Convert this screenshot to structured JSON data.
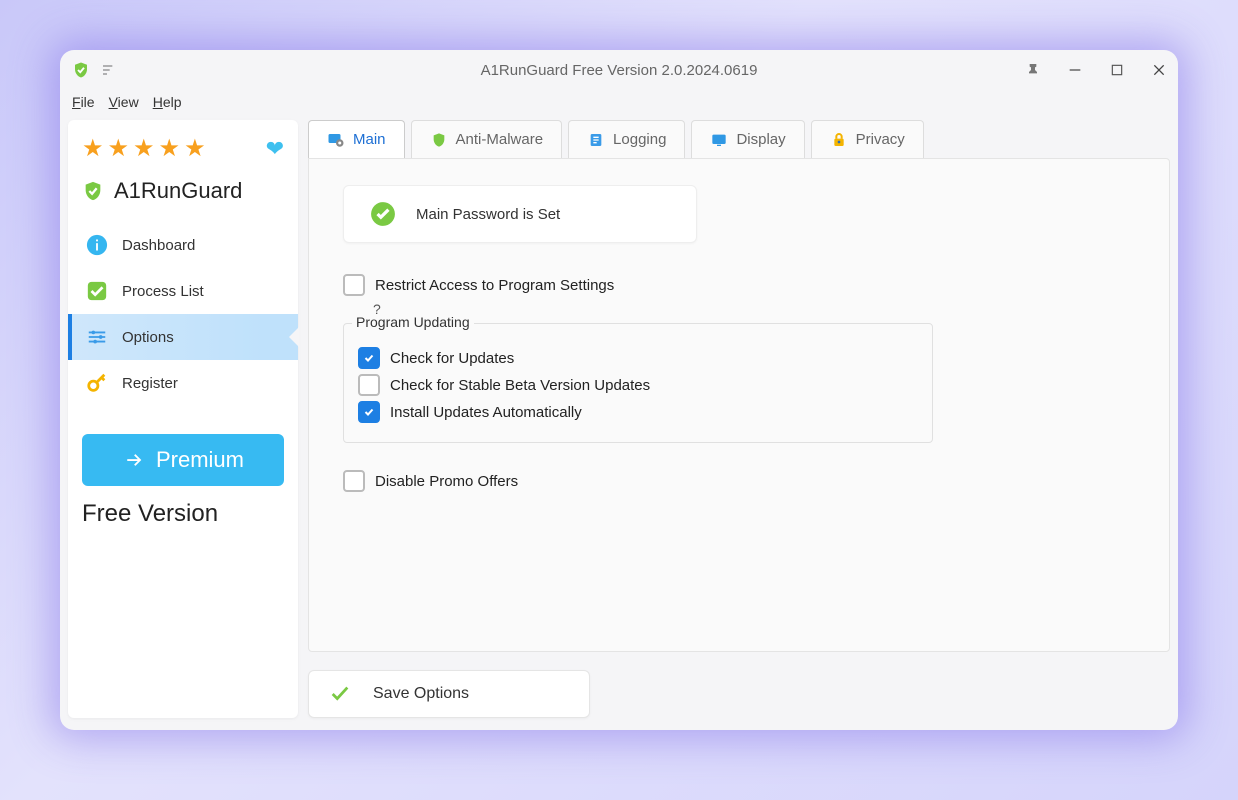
{
  "window": {
    "title": "A1RunGuard  Free Version 2.0.2024.0619"
  },
  "menu": {
    "file": "File",
    "view": "View",
    "help": "Help"
  },
  "sidebar": {
    "brand": "A1RunGuard",
    "items": [
      {
        "label": "Dashboard"
      },
      {
        "label": "Process List"
      },
      {
        "label": "Options"
      },
      {
        "label": "Register"
      }
    ],
    "premium_label": "Premium",
    "free_label": "Free Version"
  },
  "tabs": [
    {
      "label": "Main"
    },
    {
      "label": "Anti-Malware"
    },
    {
      "label": "Logging"
    },
    {
      "label": "Display"
    },
    {
      "label": "Privacy"
    }
  ],
  "main": {
    "password_card": "Main Password is Set",
    "restrict_label": "Restrict Access to Program Settings",
    "help_mark": "?",
    "group_title": "Program Updating",
    "check_updates": "Check for Updates",
    "check_beta": "Check for Stable Beta Version Updates",
    "install_auto": "Install Updates Automatically",
    "disable_promo": "Disable Promo Offers",
    "save_label": "Save Options"
  }
}
